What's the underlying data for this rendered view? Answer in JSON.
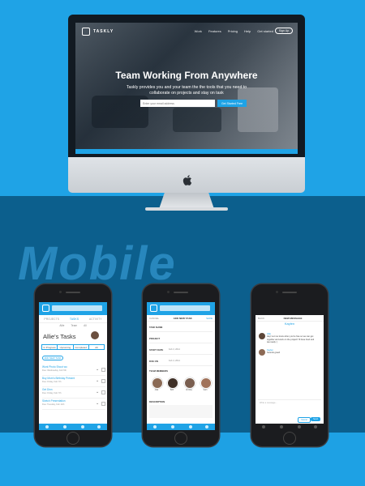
{
  "desktop": {
    "brand": "TASKLY",
    "nav": [
      "Work",
      "Features",
      "Pricing",
      "Help",
      "Get started"
    ],
    "signup_label": "Sign Up",
    "hero_title": "Team Working From Anywhere",
    "hero_subtitle": "Taskly provides you and your team the the tools that you need to collaborate on projects and stay on task",
    "email_placeholder": "Enter your email address",
    "cta_label": "Get Started Free"
  },
  "section_label": "Mobile",
  "phone1": {
    "tabs": [
      "PROJECTS",
      "TASKS",
      "ACTIVITY"
    ],
    "subtabs": [
      "Allie",
      "Team",
      "All"
    ],
    "title": "Allie's Tasks",
    "segments": [
      "In Progress",
      "Upcoming",
      "Completed",
      "All"
    ],
    "add_task": "ADD NEW TASK",
    "tasks": [
      {
        "name": "Work Photo Shoot wo",
        "date": "Due: Wednesday, Feb 5th"
      },
      {
        "name": "Buy Mom's Birthday Present",
        "date": "Due: Friday, Feb 7th"
      },
      {
        "name": "Get Dinn",
        "date": "Due: Friday, Feb 7th"
      },
      {
        "name": "Sketch Presentation",
        "date": "Due: Tuesday, Feb 11th"
      }
    ],
    "footer_note": "View Tasks"
  },
  "phone2": {
    "back": "CANCEL",
    "title": "ADD NEW TASK",
    "save": "SAVE",
    "rows": [
      {
        "label": "TASK NAME",
        "value": ""
      },
      {
        "label": "PROJECT",
        "value": ""
      },
      {
        "label": "START DATE",
        "value": "Feb 3, 2014"
      },
      {
        "label": "DUE ON",
        "value": "Feb 4, 2014"
      }
    ],
    "team_label": "TEAM MEMBERS",
    "members": [
      "Allie",
      "Bob",
      "Christie",
      "Sam"
    ],
    "desc_label": "DESCRIPTION",
    "desc_placeholder": "Enter task description"
  },
  "phone3": {
    "back": "BACK",
    "title": "NEW MESSAGE",
    "contact": "Kaylen",
    "messages": [
      {
        "from": "Allie",
        "text": "Hey! Let me know when you're free so we can get together and work on the project! I'll have food and tea ready :)"
      },
      {
        "from": "Kaylen",
        "text": "Sounds great!"
      }
    ],
    "input_placeholder": "Write a message...",
    "cancel": "Cancel",
    "send": "Send"
  }
}
